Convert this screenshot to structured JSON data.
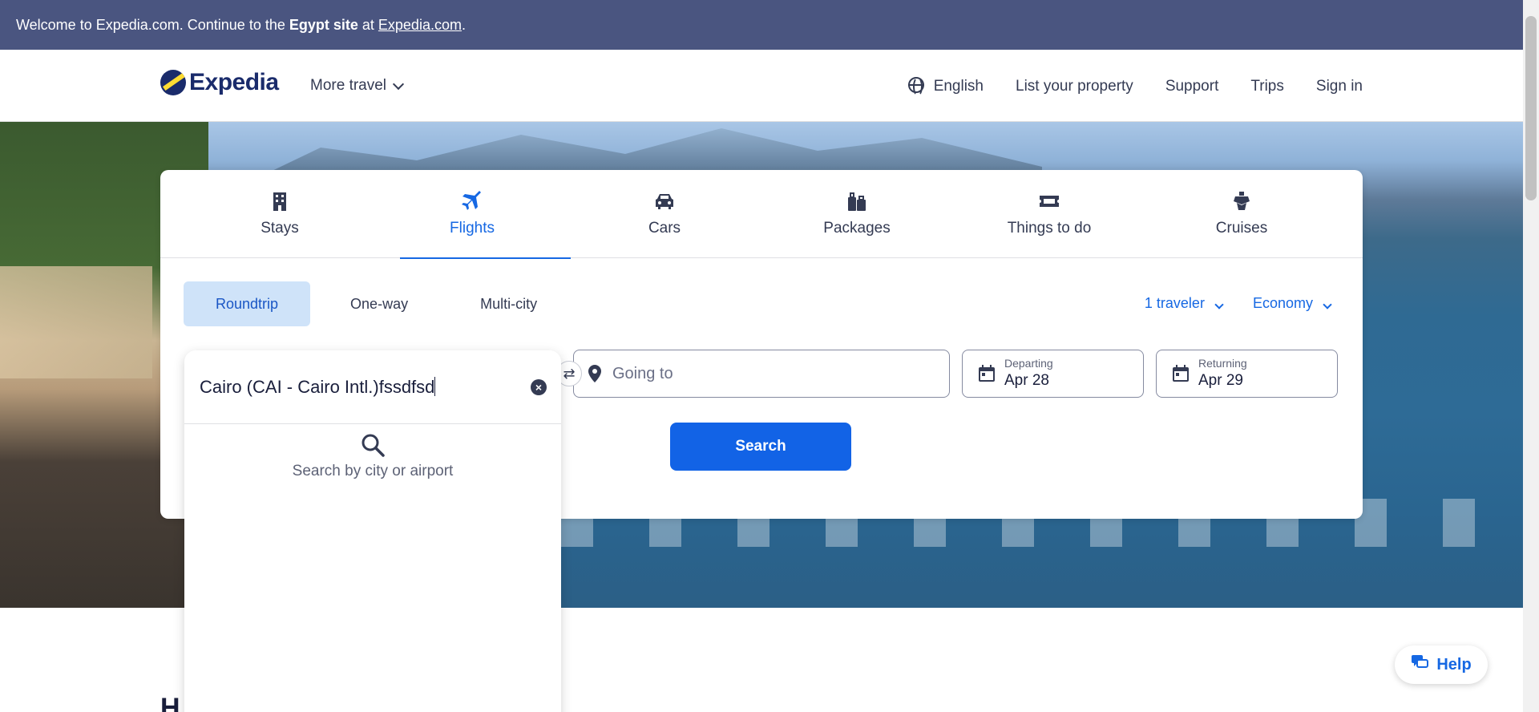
{
  "banner": {
    "prefix": "Welcome to Expedia.com. Continue to the ",
    "site": "Egypt site",
    "middle": " at ",
    "link": "Expedia.com",
    "suffix": "."
  },
  "header": {
    "logo_text": "Expedia",
    "more_travel": "More travel",
    "nav": {
      "language": "English",
      "list_property": "List your property",
      "support": "Support",
      "trips": "Trips",
      "sign_in": "Sign in"
    }
  },
  "tabs": [
    {
      "label": "Stays",
      "icon": "building-icon"
    },
    {
      "label": "Flights",
      "icon": "plane-icon",
      "active": true
    },
    {
      "label": "Cars",
      "icon": "car-icon"
    },
    {
      "label": "Packages",
      "icon": "luggage-icon"
    },
    {
      "label": "Things to do",
      "icon": "ticket-icon"
    },
    {
      "label": "Cruises",
      "icon": "ship-icon"
    }
  ],
  "trip_types": [
    "Roundtrip",
    "One-way",
    "Multi-city"
  ],
  "options": {
    "travelers": "1 traveler",
    "cabin": "Economy"
  },
  "search": {
    "from_value": "Cairo (CAI - Cairo Intl.)fssdfsd",
    "to_placeholder": "Going to",
    "departing_label": "Departing",
    "departing_value": "Apr 28",
    "returning_label": "Returning",
    "returning_value": "Apr 29",
    "button": "Search",
    "hint": "Search by city or airport"
  },
  "below": {
    "title": "H                              nove"
  },
  "help": {
    "label": "Help"
  },
  "colors": {
    "brand_blue": "#1668e3",
    "banner_bg": "#4a5580",
    "search_button": "#1263e6",
    "active_trip_bg": "#cfe3f9"
  }
}
